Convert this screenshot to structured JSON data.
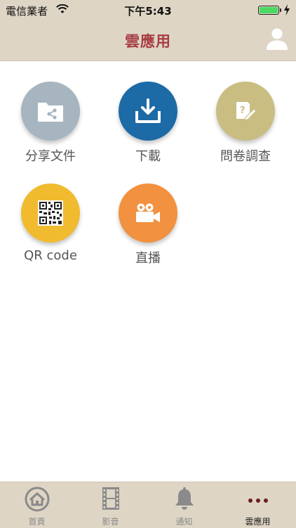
{
  "status_bar": {
    "carrier": "電信業者",
    "time": "下午5:43"
  },
  "nav": {
    "title": "雲應用",
    "user_icon": "user-icon"
  },
  "apps": [
    {
      "label": "分享文件",
      "icon": "share-folder-icon",
      "color": "#a6b5bf"
    },
    {
      "label": "下載",
      "icon": "download-icon",
      "color": "#1c6aa6"
    },
    {
      "label": "問卷調查",
      "icon": "survey-icon",
      "color": "#c9bd82"
    },
    {
      "label": "QR code",
      "icon": "qr-code-icon",
      "color": "#f0bb2f"
    },
    {
      "label": "直播",
      "icon": "video-camera-icon",
      "color": "#f2913f"
    }
  ],
  "tabs": [
    {
      "label": "首頁",
      "icon": "home-icon"
    },
    {
      "label": "影音",
      "icon": "film-icon"
    },
    {
      "label": "通知",
      "icon": "bell-icon"
    },
    {
      "label": "雲應用",
      "icon": "more-icon",
      "active": true
    }
  ]
}
